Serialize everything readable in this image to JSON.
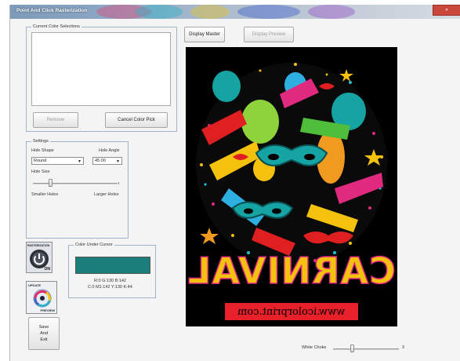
{
  "window": {
    "title": "Point And Click Rasterization"
  },
  "color_selections": {
    "group_label": "Current Color Selections",
    "remove_label": "Remove",
    "cancel_label": "Cancel Color Pick"
  },
  "settings": {
    "group_label": "Settings",
    "hole_shape_label": "Hole Shape",
    "hole_shape_value": "Round",
    "hole_angle_label": "Hole Angle",
    "hole_angle_value": "45.00",
    "hole_size_label": "Hole Size",
    "smaller_label": "Smaller Holes",
    "larger_label": "Larger Holes",
    "hole_size_value": 4
  },
  "rasterization": {
    "label": "RASTERIZATION",
    "state": "ON"
  },
  "update_preview": {
    "label_top": "UPDATE",
    "label_bottom": "PREVIEW"
  },
  "save_exit": {
    "label": "Save\nAnd\nExit"
  },
  "color_under_cursor": {
    "group_label": "Color Under Cursor",
    "swatch_color": "#1a7f7a",
    "rgb_line": "R:0   G:130   B:142",
    "cmyk_line": "C:0 M1:142 Y:130 K:44"
  },
  "view_tabs": {
    "master_label": "Display Master",
    "preview_label": "Display Preview"
  },
  "poster": {
    "headline": "CARNIVAL",
    "url": "www.icolorprint.com"
  },
  "white_choke": {
    "label": "White Choke",
    "value": "3"
  },
  "colors": {
    "teal": "#15a3a3",
    "red": "#e02020",
    "yellow": "#f4c20d"
  }
}
